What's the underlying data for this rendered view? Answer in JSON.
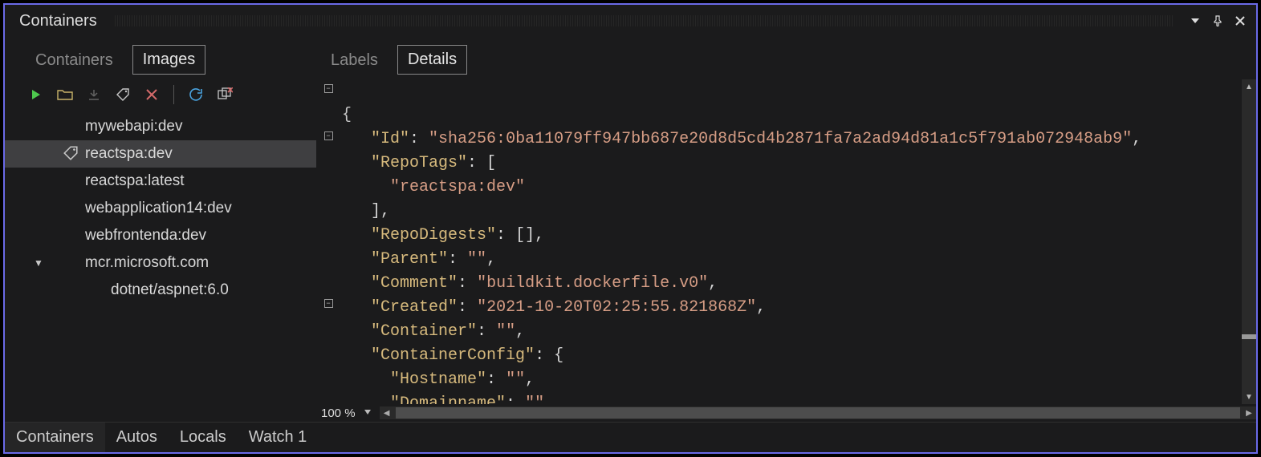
{
  "window": {
    "title": "Containers"
  },
  "left": {
    "tabs": {
      "inactive": "Containers",
      "active": "Images"
    },
    "tree": [
      {
        "label": "mywebapi:dev",
        "depth": 1,
        "selected": false
      },
      {
        "label": "reactspa:dev",
        "depth": 1,
        "selected": true,
        "tagged": true
      },
      {
        "label": "reactspa:latest",
        "depth": 1,
        "selected": false
      },
      {
        "label": "webapplication14:dev",
        "depth": 1,
        "selected": false
      },
      {
        "label": "webfrontenda:dev",
        "depth": 1,
        "selected": false
      },
      {
        "label": "mcr.microsoft.com",
        "depth": 1,
        "selected": false,
        "expander": "▼"
      },
      {
        "label": "dotnet/aspnet:6.0",
        "depth": 2,
        "selected": false
      }
    ]
  },
  "right": {
    "tabs": {
      "inactive": "Labels",
      "active": "Details"
    },
    "zoom": "100 %",
    "json": {
      "Id": "sha256:0ba11079ff947bb687e20d8d5cd4b2871fa7a2ad94d81a1c5f791ab072948ab9",
      "RepoTags": [
        "reactspa:dev"
      ],
      "RepoDigests": [],
      "Parent": "",
      "Comment": "buildkit.dockerfile.v0",
      "Created": "2021-10-20T02:25:55.821868Z",
      "Container": "",
      "ContainerConfig": {
        "Hostname": "",
        "Domainname": ""
      }
    },
    "lines": {
      "l0": "{",
      "l1_k": "\"Id\"",
      "l1_v": "\"sha256:0ba11079ff947bb687e20d8d5cd4b2871fa7a2ad94d81a1c5f791ab072948ab9\"",
      "l2_k": "\"RepoTags\"",
      "l3_v": "\"reactspa:dev\"",
      "l4": "],",
      "l5_k": "\"RepoDigests\"",
      "l5_v": "[]",
      "l6_k": "\"Parent\"",
      "l6_v": "\"\"",
      "l7_k": "\"Comment\"",
      "l7_v": "\"buildkit.dockerfile.v0\"",
      "l8_k": "\"Created\"",
      "l8_v": "\"2021-10-20T02:25:55.821868Z\"",
      "l9_k": "\"Container\"",
      "l9_v": "\"\"",
      "l10_k": "\"ContainerConfig\"",
      "l11_k": "\"Hostname\"",
      "l11_v": "\"\"",
      "l12_k": "\"Domainname\"",
      "l12_v": "\"\""
    }
  },
  "bottomTabs": {
    "t0": "Containers",
    "t1": "Autos",
    "t2": "Locals",
    "t3": "Watch 1"
  }
}
